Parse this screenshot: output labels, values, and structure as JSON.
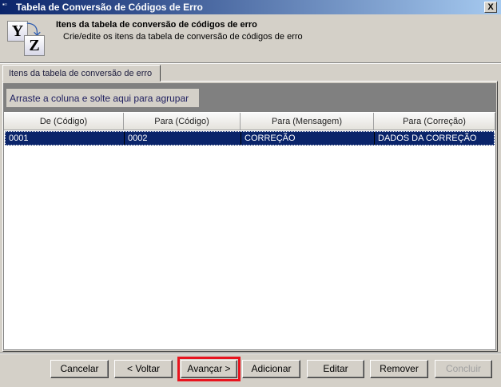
{
  "window": {
    "title": "Tabela de Conversão de Códigos de Erro",
    "close": "X"
  },
  "header": {
    "title": "Itens da tabela de conversão de códigos de erro",
    "subtitle": "Crie/edite os itens da tabela de conversão de códigos de erro",
    "icon_letters": [
      "Y",
      "Z"
    ]
  },
  "tabs": [
    {
      "label": "Itens da tabela de conversão de erro"
    }
  ],
  "grid": {
    "group_hint": "Arraste a coluna e solte aqui para agrupar",
    "columns": [
      "De (Código)",
      "Para (Código)",
      "Para (Mensagem)",
      "Para (Correção)"
    ],
    "rows": [
      [
        "0001",
        "0002",
        "CORREÇÃO",
        "DADOS DA CORREÇÃO"
      ]
    ]
  },
  "buttons": {
    "cancel": "Cancelar",
    "back": "< Voltar",
    "next": "Avançar >",
    "add": "Adicionar",
    "edit": "Editar",
    "remove": "Remover",
    "finish": "Concluir"
  },
  "colors": {
    "selection": "#0a246a",
    "highlight": "#e8141e"
  }
}
